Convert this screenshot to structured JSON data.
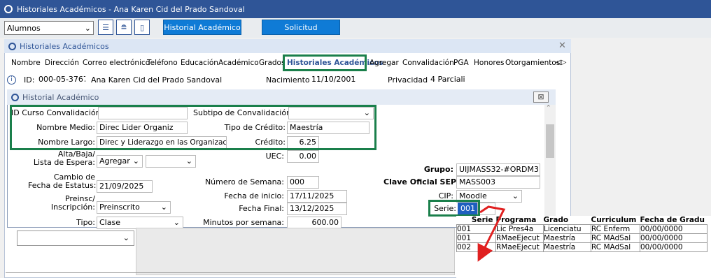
{
  "window_title": "Historiales Académicos - Ana Karen Cid del Prado Sandoval",
  "toolbar": {
    "combo_value": "Alumnos",
    "btn_historial": "Historial Académico",
    "btn_solicitud": "Solicitud"
  },
  "list_window": {
    "title": "Historiales Académicos",
    "close": "✕"
  },
  "tabs": [
    "Nombre",
    "Dirección",
    "Correo electrónico",
    "Teléfono",
    "Educación",
    "Académico",
    "Grados",
    "Historiales Académicos",
    "Agregar",
    "Convalidación",
    "PGA",
    "Honores",
    "Otorgamientos"
  ],
  "info": {
    "id_label": "ID:",
    "id_value": "000-05-3767",
    "name": "Ana Karen Cid del Prado Sandoval",
    "birth_label": "Nacimiento:",
    "birth_value": "11/10/2001",
    "privacy_label": "Privacidad:",
    "privacy_value": "4 Parciali"
  },
  "dialog": {
    "title": "Historial Académico",
    "close": "⊠",
    "id_curso_label": "ID Curso Convalidación:",
    "id_curso_value": "",
    "subtipo_label": "Subtipo de Convalidación:",
    "subtipo_value": "",
    "nombre_medio_label": "Nombre Medio:",
    "nombre_medio_value": "Direc Lider Organiz",
    "tipo_credito_label": "Tipo de Crédito:",
    "tipo_credito_value": "Maestría",
    "nombre_largo_label": "Nombre Largo:",
    "nombre_largo_value": "Direc y Liderazgo en las Organizacion",
    "credito_label": "Crédito:",
    "credito_value": "6.25",
    "alta_label": "Alta/Baja/\nLista de Espera:",
    "alta_value": "Agregar",
    "uec_label": "UEC:",
    "uec_value": "0.00",
    "grupo_label": "Grupo:",
    "grupo_value": "UIJMASS32-#ORDM3",
    "cambio_label": "Cambio de\nFecha de Estatus:",
    "cambio_value": "21/09/2025",
    "semana_label": "Número de Semana:",
    "semana_value": "000",
    "clave_label": "Clave Oficial SEP:",
    "clave_value": "MASS003",
    "inicio_label": "Fecha de inicio:",
    "inicio_value": "17/11/2025",
    "cip_label": "CIP:",
    "cip_value": "Moodle",
    "preinsc_label": "Preinsc/\nInscripción:",
    "preinsc_value": "Preinscrito",
    "final_label": "Fecha Final:",
    "final_value": "13/12/2025",
    "serie_label": "Serie:",
    "serie_value": "001",
    "tipo_label": "Tipo:",
    "tipo_value": "Clase",
    "minutos_label": "Minutos por semana:",
    "minutos_value": "600.00"
  },
  "series_table": {
    "headers": [
      "Serie",
      "Programa",
      "Grado",
      "Curriculum",
      "Fecha de Gradu"
    ],
    "rows": [
      [
        "001",
        "Lic Pres4a",
        "Licenciatu",
        "RC Enferm",
        "00/00/0000"
      ],
      [
        "001",
        "RMaeEjecut",
        "Maestría",
        "RC MAdSal",
        "00/00/0000"
      ],
      [
        "002",
        "RMaeEjecut",
        "Maestría",
        "RC MAdSal",
        "00/00/0000"
      ]
    ]
  },
  "colors": {
    "title_bg": "#2f5597",
    "accent_green": "#1a7f4b",
    "arrow_red": "#e02020",
    "button_blue": "#0f7bd6"
  }
}
